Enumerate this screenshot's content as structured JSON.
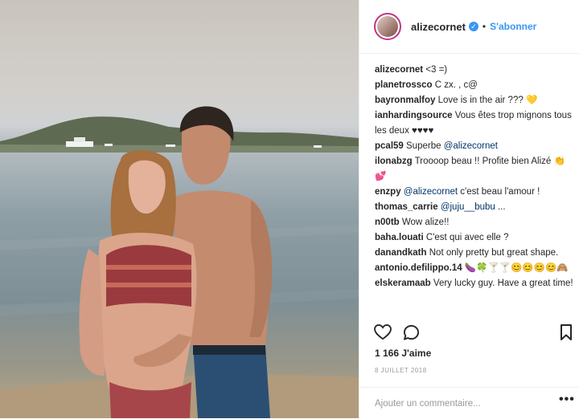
{
  "post": {
    "username": "alizecornet",
    "verified_glyph": "✓",
    "separator": "•",
    "follow_label": "S'abonner",
    "comments": [
      {
        "user": "alizecornet",
        "text": "<3 =)"
      },
      {
        "user": "planetrossco",
        "text": "C zx. , c@"
      },
      {
        "user": "bayronmalfoy",
        "text": "Love is in the air ??? 💛"
      },
      {
        "user": "ianhardingsource",
        "text": "Vous êtes trop mignons tous les deux ♥♥♥♥"
      },
      {
        "user": "pcal59",
        "text": "Superbe",
        "mention": "@alizecornet"
      },
      {
        "user": "ilonabzg",
        "text": "Troooop beau !! Profite bien Alizé 👏💕"
      },
      {
        "user": "enzpy",
        "mention": "@alizecornet",
        "text": "c'est beau l'amour !"
      },
      {
        "user": "thomas_carrie",
        "mention": "@juju__bubu",
        "text": "..."
      },
      {
        "user": "n00tb",
        "text": "Wow alize!!"
      },
      {
        "user": "baha.louati",
        "text": "C'est qui avec elle ?"
      },
      {
        "user": "danandkath",
        "text": "Not only pretty but great shape."
      },
      {
        "user": "antonio.defilippo.14",
        "text": "🍆🍀🍸🍸😊😊😊😊🙈"
      },
      {
        "user": "elskeramaab",
        "text": "Very lucky guy. Have a great time!"
      }
    ],
    "icons": {
      "like": "heart-icon",
      "comment": "comment-icon",
      "save": "bookmark-icon",
      "more": "more-options-icon"
    },
    "likes": "1 166 J'aime",
    "date": "8 JUILLET 2018",
    "comment_placeholder": "Ajouter un commentaire...",
    "more_glyph": "•••"
  },
  "colors": {
    "link": "#3897f0",
    "mention": "#003569",
    "text": "#262626",
    "muted": "#999999"
  }
}
